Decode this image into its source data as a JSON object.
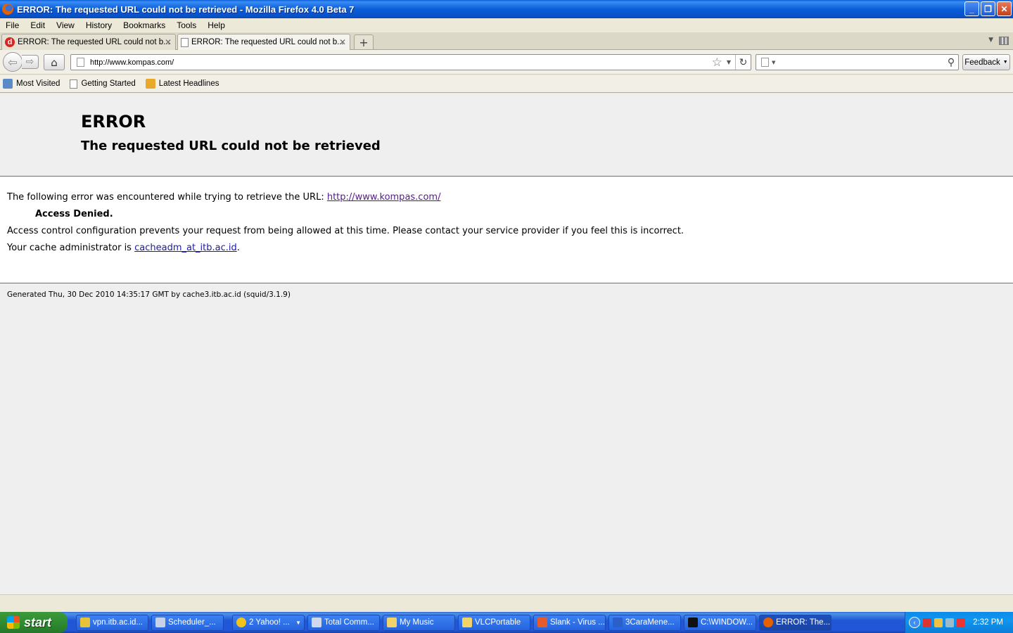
{
  "window": {
    "title": "ERROR: The requested URL could not be retrieved - Mozilla Firefox 4.0 Beta 7",
    "minimize": "_",
    "restore": "❐",
    "close": "✕"
  },
  "menubar": [
    "File",
    "Edit",
    "View",
    "History",
    "Bookmarks",
    "Tools",
    "Help"
  ],
  "tabs": [
    {
      "label": "ERROR: The requested URL could not b...",
      "favicon": "d",
      "active": false
    },
    {
      "label": "ERROR: The requested URL could not b...",
      "favicon": "page-icon",
      "active": true
    }
  ],
  "newtab_label": "+",
  "navbar": {
    "url": "http://www.kompas.com/",
    "search_placeholder": "",
    "feedback_label": "Feedback"
  },
  "bookmarks": [
    {
      "label": "Most Visited"
    },
    {
      "label": "Getting Started"
    },
    {
      "label": "Latest Headlines"
    }
  ],
  "page": {
    "title": "ERROR",
    "subtitle": "The requested URL could not be retrieved",
    "intro": "The following error was encountered while trying to retrieve the URL:",
    "intro_link": "http://www.kompas.com/",
    "denied": "Access Denied.",
    "explanation": "Access control configuration prevents your request from being allowed at this time. Please contact your service provider if you feel this is incorrect.",
    "admin_prefix": "Your cache administrator is",
    "admin_link": "cacheadm_at_itb.ac.id",
    "admin_suffix": ".",
    "footer": "Generated Thu, 30 Dec 2010 14:35:17 GMT by cache3.itb.ac.id (squid/3.1.9)"
  },
  "taskbar": {
    "start_label": "start",
    "tasks": [
      {
        "label": "vpn.itb.ac.id...",
        "icon": "chrome-icon",
        "color": "#e8c33a"
      },
      {
        "label": "Scheduler_...",
        "icon": "cube-icon",
        "color": "#c7d2e8"
      },
      {
        "label": "2 Yahoo! ...",
        "icon": "yahoo-smiley-icon",
        "color": "#f2c318",
        "dropdown": true
      },
      {
        "label": "Total Comm...",
        "icon": "floppy-icon",
        "color": "#d0d8ec"
      },
      {
        "label": "My Music",
        "icon": "music-folder-icon",
        "color": "#f2d36a"
      },
      {
        "label": "VLCPortable",
        "icon": "folder-icon",
        "color": "#f2d36a"
      },
      {
        "label": "Slank - Virus ...",
        "icon": "media-player-icon",
        "color": "#e55b2b"
      },
      {
        "label": "3CaraMene...",
        "icon": "word-icon",
        "color": "#2b5fc9"
      },
      {
        "label": "C:\\WINDOW...",
        "icon": "cmd-icon",
        "color": "#111111"
      },
      {
        "label": "ERROR: The...",
        "icon": "firefox-icon",
        "color": "#e66000",
        "active": true
      }
    ],
    "clock": "2:32 PM"
  }
}
